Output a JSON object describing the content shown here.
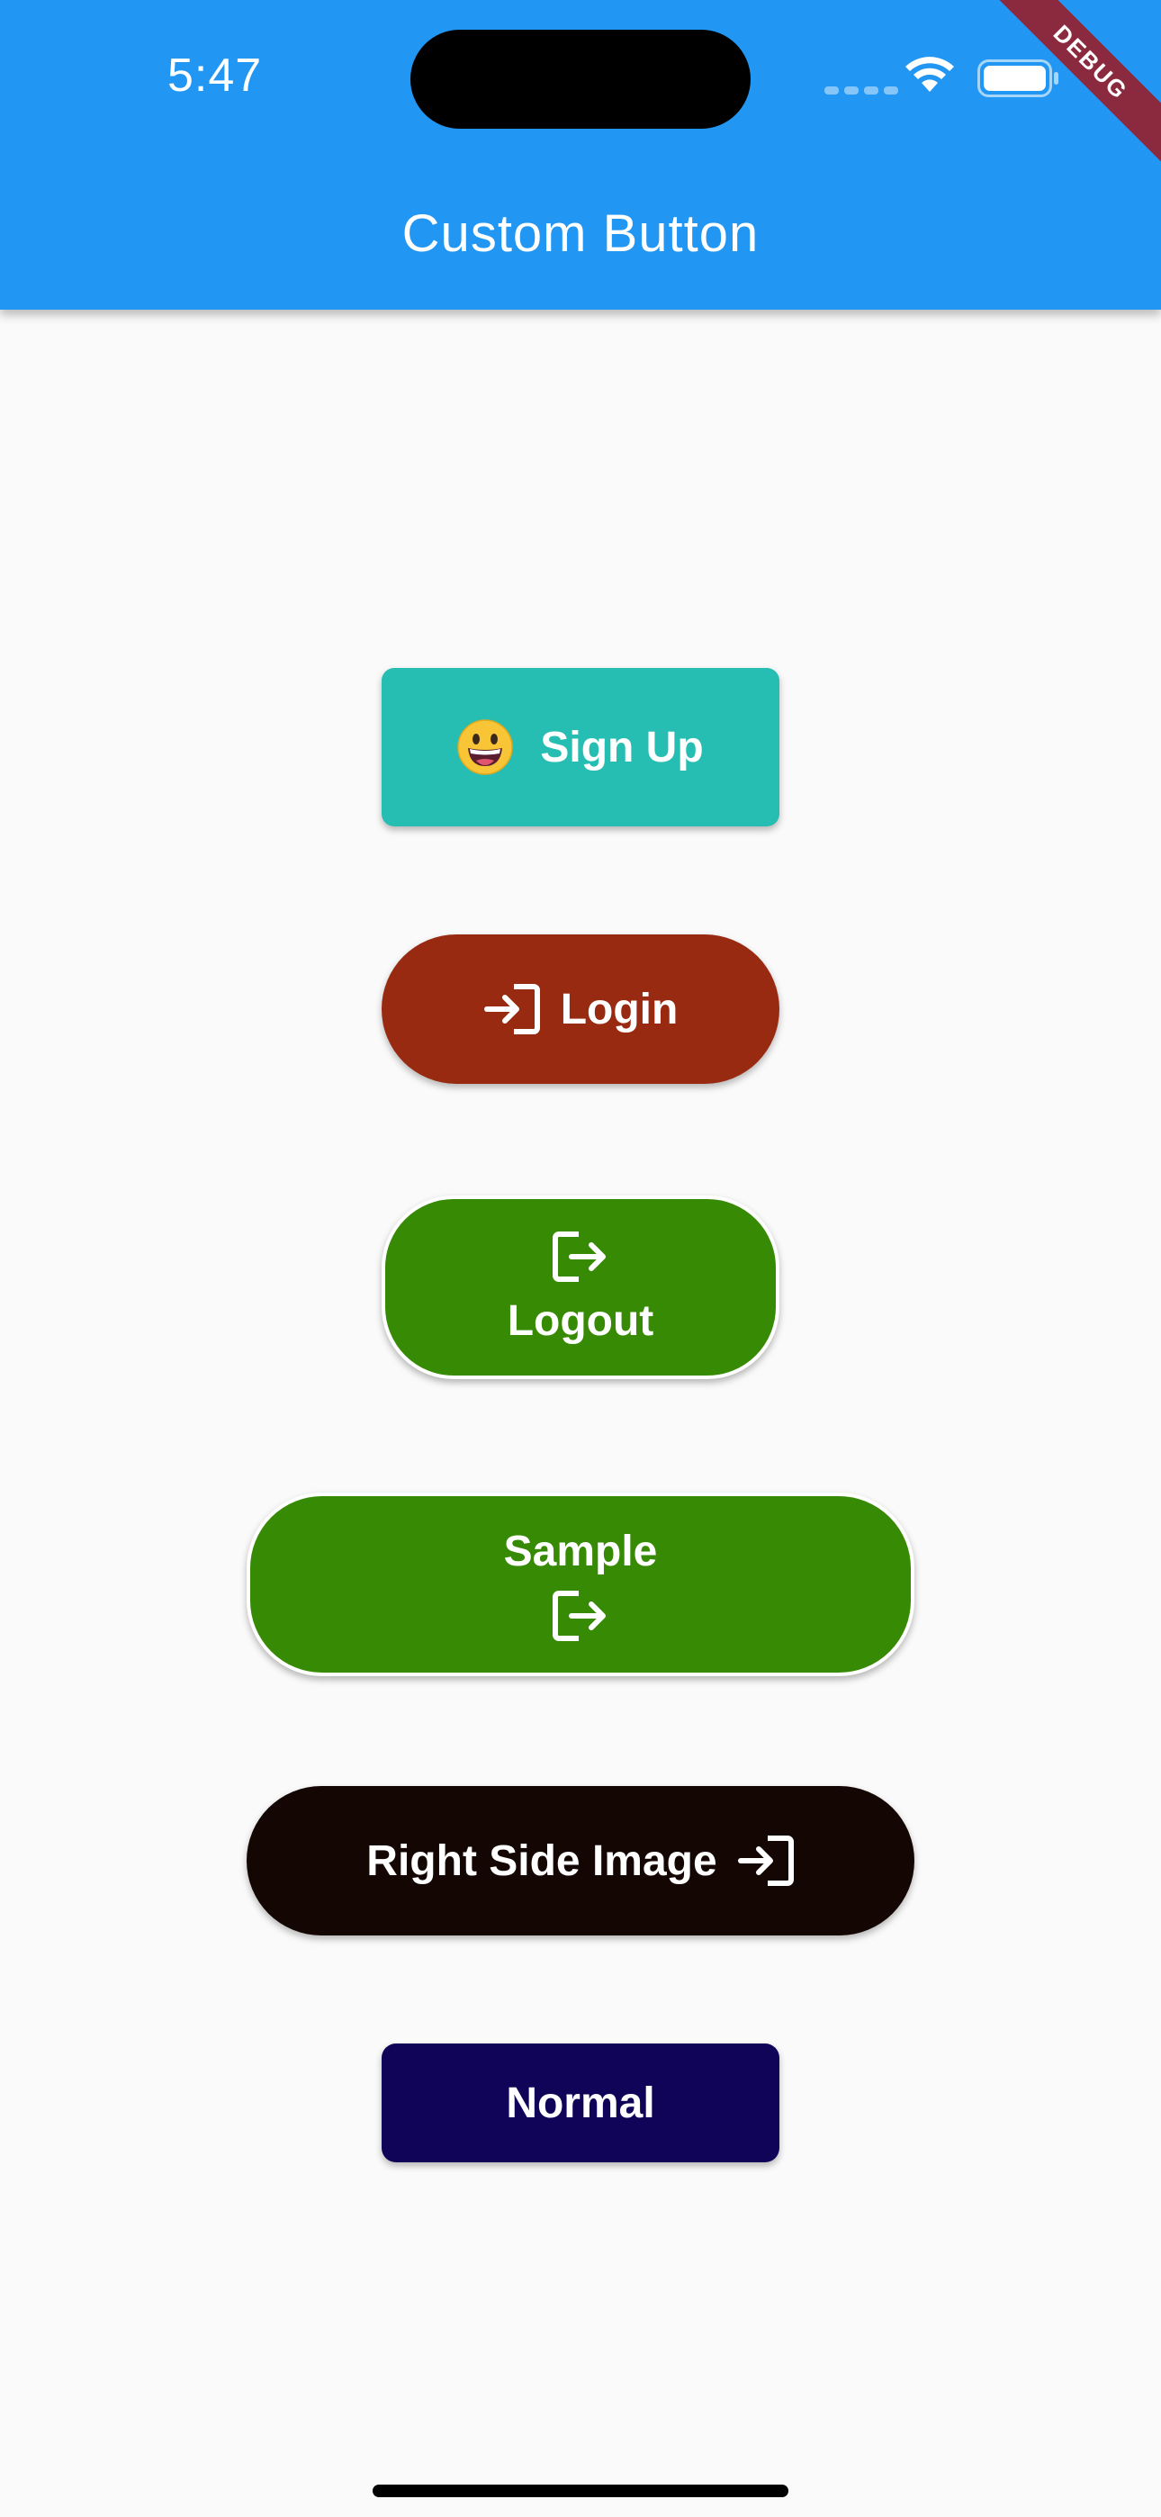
{
  "status_bar": {
    "time": "5:47",
    "icons": [
      "cellular-dots-icon",
      "wifi-icon",
      "battery-icon"
    ]
  },
  "debug_banner": "DEBUG",
  "app_bar": {
    "title": "Custom Button",
    "color": "#2196f3"
  },
  "buttons": {
    "signup": {
      "label": "Sign Up",
      "icon": "grinning-face-emoji-icon",
      "color": "#26bdb3"
    },
    "login": {
      "label": "Login",
      "icon": "login-icon",
      "color": "#992a12"
    },
    "logout": {
      "label": "Logout",
      "icon": "logout-icon",
      "color": "#368a04"
    },
    "sample": {
      "label": "Sample",
      "icon": "logout-icon",
      "color": "#368a04"
    },
    "right_side": {
      "label": "Right Side Image",
      "icon": "login-icon",
      "color": "#140603"
    },
    "normal": {
      "label": "Normal",
      "color": "#0f0457"
    }
  }
}
